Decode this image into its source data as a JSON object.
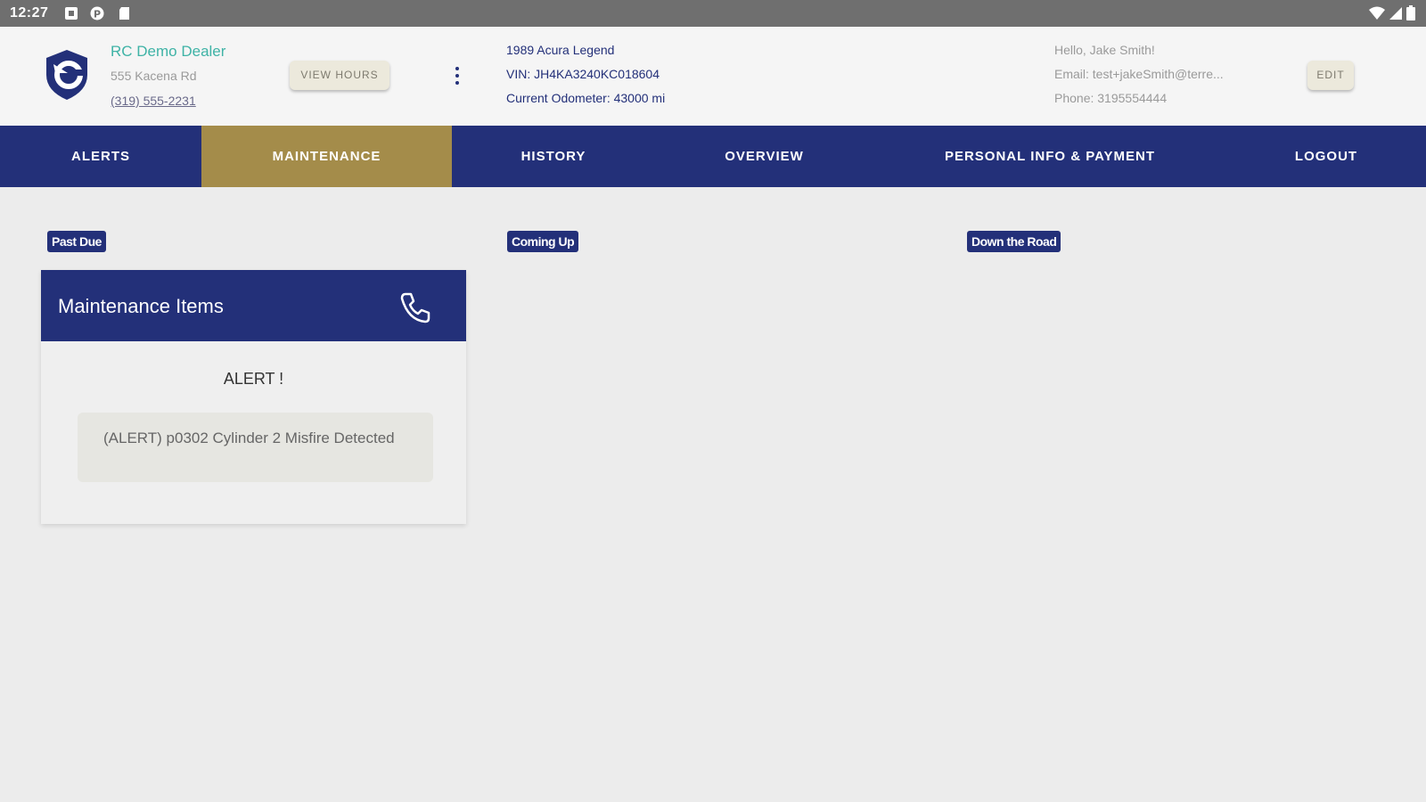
{
  "status_bar": {
    "time": "12:27",
    "icons": [
      "notification-icon",
      "pinterest-icon",
      "sd-card-icon",
      "wifi-icon",
      "signal-icon",
      "battery-icon"
    ]
  },
  "dealer": {
    "name": "RC Demo Dealer",
    "address": "555 Kacena Rd",
    "phone": "(319) 555-2231",
    "view_hours_label": "VIEW HOURS"
  },
  "vehicle": {
    "title": "1989 Acura Legend",
    "vin": "VIN: JH4KA3240KC018604",
    "odometer": "Current Odometer: 43000 mi"
  },
  "user": {
    "greeting": "Hello, Jake Smith!",
    "email": "Email: test+jakeSmith@terre...",
    "phone": "Phone: 3195554444",
    "edit_label": "EDIT"
  },
  "nav": {
    "tabs": [
      {
        "label": "ALERTS",
        "active": false
      },
      {
        "label": "MAINTENANCE",
        "active": true
      },
      {
        "label": "HISTORY",
        "active": false
      },
      {
        "label": "OVERVIEW",
        "active": false
      },
      {
        "label": "PERSONAL INFO & PAYMENT",
        "active": false
      },
      {
        "label": "LOGOUT",
        "active": false
      }
    ]
  },
  "columns": {
    "past_due": "Past Due",
    "coming_up": "Coming Up",
    "down_the_road": "Down the Road"
  },
  "card": {
    "title": "Maintenance Items",
    "alert_heading": "ALERT !",
    "alert_text": "(ALERT) p0302 Cylinder 2 Misfire Detected"
  },
  "colors": {
    "navy": "#233079",
    "gold_active_tab": "#a48c4a",
    "teal_dealer": "#3fb3a6",
    "background": "#ececec"
  }
}
